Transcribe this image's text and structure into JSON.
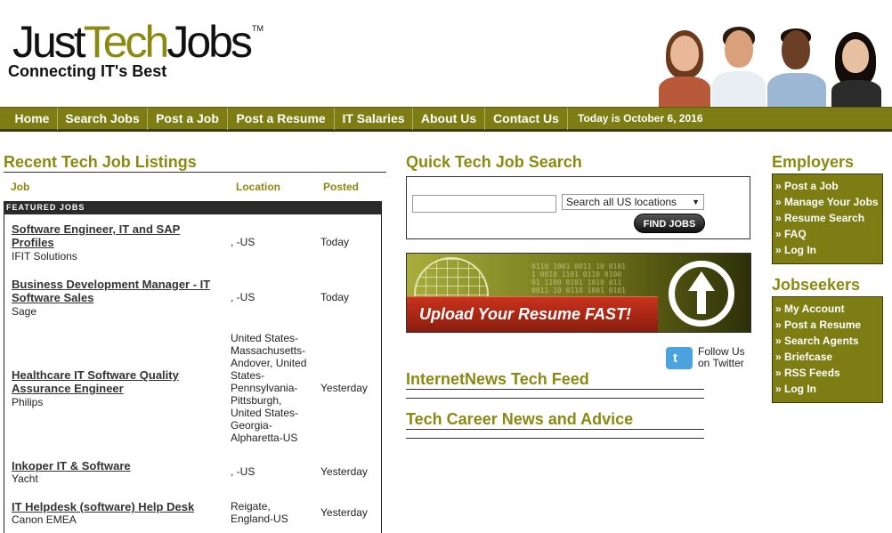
{
  "header": {
    "logo_just": "Just",
    "logo_tech": "Tech",
    "logo_jobs": "Jobs",
    "logo_tm": "TM",
    "tagline": "Connecting IT's Best"
  },
  "nav": {
    "items": [
      "Home",
      "Search Jobs",
      "Post a Job",
      "Post a Resume",
      "IT Salaries",
      "About Us",
      "Contact Us"
    ],
    "date": "Today is October 6, 2016"
  },
  "listings": {
    "title": "Recent Tech Job Listings",
    "col_job": "Job",
    "col_location": "Location",
    "col_posted": "Posted",
    "featured_label": "FEATURED JOBS",
    "jobs": [
      {
        "title": "Software Engineer, IT and SAP Profiles",
        "company": "IFIT Solutions",
        "location": ", -US",
        "posted": "Today"
      },
      {
        "title": "Business Development Manager - IT Software Sales",
        "company": "Sage",
        "location": ", -US",
        "posted": "Today"
      },
      {
        "title": "Healthcare IT Software Quality Assurance Engineer",
        "company": "Philips",
        "location": "United States-Massachusetts-Andover, United States-Pennsylvania-Pittsburgh, United States-Georgia-Alpharetta-US",
        "posted": "Yesterday"
      },
      {
        "title": "Inkoper IT & Software",
        "company": "Yacht",
        "location": ", -US",
        "posted": "Yesterday"
      },
      {
        "title": "IT Helpdesk (software) Help Desk",
        "company": "Canon EMEA",
        "location": "Reigate, England-US",
        "posted": "Yesterday"
      }
    ]
  },
  "quick_search": {
    "title": "Quick Tech Job Search",
    "input_value": "",
    "select_value": "Search all US locations",
    "button_label": "FIND JOBS"
  },
  "banner": {
    "text": "Upload Your Resume FAST!"
  },
  "twitter": {
    "line1": "Follow Us",
    "line2": "on Twitter"
  },
  "feeds": {
    "internetnews": "InternetNews Tech Feed",
    "career_news": "Tech Career News and Advice"
  },
  "employers": {
    "title": "Employers",
    "items": [
      "» Post a Job",
      "» Manage Your Jobs",
      "» Resume Search",
      "» FAQ",
      "» Log In"
    ]
  },
  "jobseekers": {
    "title": "Jobseekers",
    "items": [
      "» My Account",
      "» Post a Resume",
      "» Search Agents",
      "» Briefcase",
      "» RSS Feeds",
      "» Log In"
    ]
  },
  "colors": {
    "olive": "#7d7d14",
    "title_olive": "#8a8a12",
    "dark_band": "#2a2a2a",
    "twitter_blue": "#4aa3df",
    "banner_red": "#c8331d"
  }
}
